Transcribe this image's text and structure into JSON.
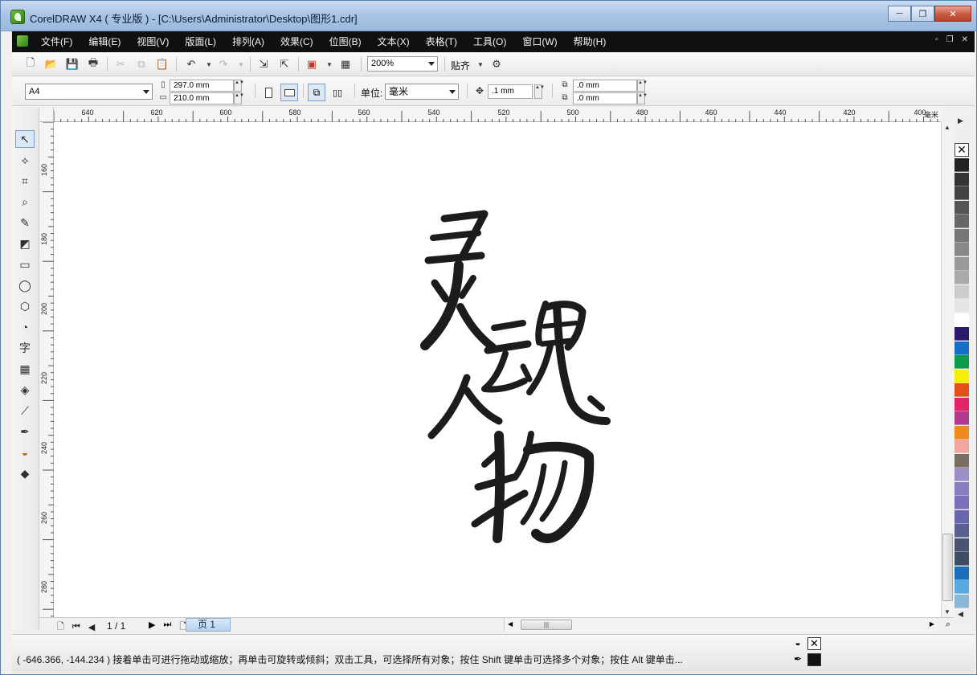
{
  "window": {
    "title": "CorelDRAW X4 ( 专业版 ) - [C:\\Users\\Administrator\\Desktop\\图形1.cdr]",
    "min_label": "─",
    "max_label": "❐",
    "close_label": "✕"
  },
  "menu": {
    "items": [
      "文件(F)",
      "编辑(E)",
      "视图(V)",
      "版面(L)",
      "排列(A)",
      "效果(C)",
      "位图(B)",
      "文本(X)",
      "表格(T)",
      "工具(O)",
      "窗口(W)",
      "帮助(H)"
    ],
    "mdi": [
      "▫",
      "❐",
      "✕"
    ]
  },
  "standard_toolbar": {
    "zoom": "200%",
    "snap_label": "贴齐"
  },
  "property_bar": {
    "paper_size": "A4",
    "width": "297.0 mm",
    "height": "210.0 mm",
    "unit_label": "单位:",
    "unit": "毫米",
    "nudge": ".1 mm",
    "dup_x": ".0 mm",
    "dup_y": ".0 mm"
  },
  "rulers": {
    "unit": "毫米",
    "horizontal_labels": [
      "640",
      "620",
      "600",
      "580",
      "560",
      "540",
      "520",
      "500",
      "480",
      "460",
      "440",
      "420",
      "400"
    ],
    "vertical_labels": [
      "160",
      "180",
      "200",
      "220",
      "240",
      "260",
      "280"
    ]
  },
  "canvas": {
    "artwork_characters": "灵魂人物"
  },
  "page_navigator": {
    "count": "1 / 1",
    "tab_label": "页 1"
  },
  "status": {
    "text": "( -646.366, -144.234 )  接着单击可进行拖动或缩放；再单击可旋转或倾斜；双击工具，可选择所有对象；按住 Shift 键单击可选择多个对象；按住 Alt 键单击..."
  },
  "colors": {
    "accent": "#7d9cc4",
    "menubar_bg": "#101010",
    "ink": "#1c1c1c"
  },
  "palette_colors": [
    "#222222",
    "#333333",
    "#444444",
    "#555555",
    "#666666",
    "#777777",
    "#888888",
    "#999999",
    "#aaaaaa",
    "#cccccc",
    "#e6e6e6",
    "#ffffff",
    "#2b1a6e",
    "#1670c8",
    "#0c9c4a",
    "#f6ef00",
    "#e4501a",
    "#e0246a",
    "#b23a8c",
    "#f08a1c",
    "#f3a5a0",
    "#7a6e62",
    "#9b8fc6",
    "#8a7cc0",
    "#7a6fb8",
    "#6a66ac",
    "#5a5e90",
    "#4b5372",
    "#3f4d63",
    "#1c6fba",
    "#58a9e2",
    "#8cb6d6"
  ]
}
